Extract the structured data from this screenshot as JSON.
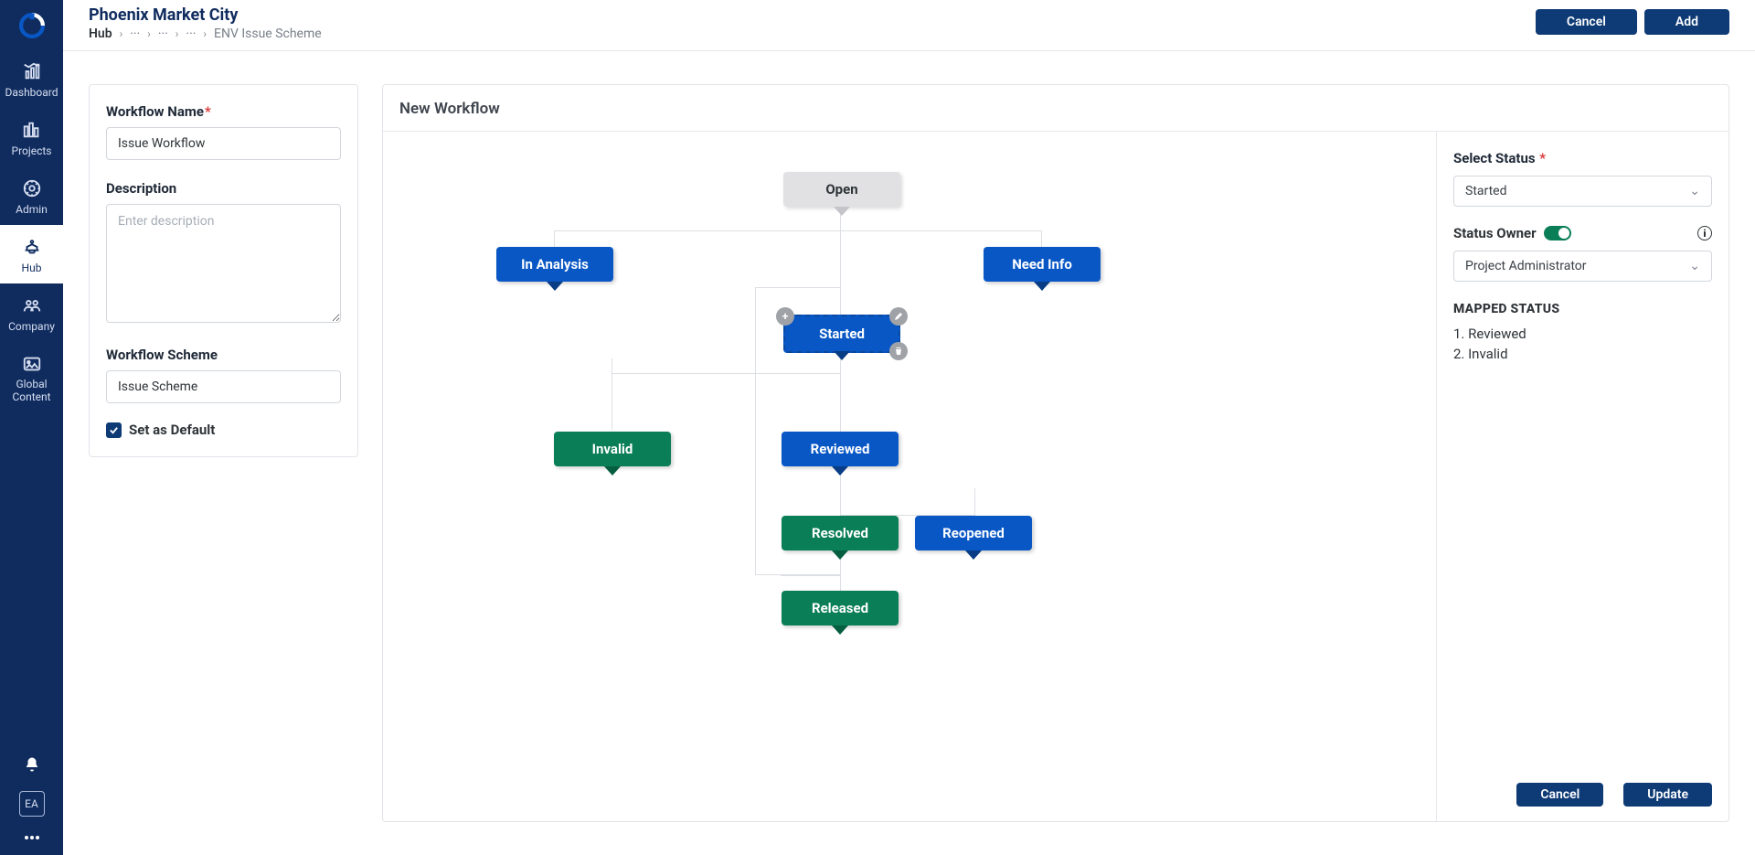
{
  "sidebar": {
    "items": [
      {
        "label": "Dashboard"
      },
      {
        "label": "Projects"
      },
      {
        "label": "Admin"
      },
      {
        "label": "Hub"
      },
      {
        "label": "Company"
      },
      {
        "label": "Global Content"
      }
    ],
    "avatar": "EA"
  },
  "header": {
    "title": "Phoenix Market City",
    "breadcrumb": {
      "root": "Hub",
      "dots": "···",
      "leaf": "ENV Issue Scheme"
    },
    "cancel": "Cancel",
    "add": "Add"
  },
  "form": {
    "name_label": "Workflow Name",
    "name_value": "Issue Workflow",
    "desc_label": "Description",
    "desc_placeholder": "Enter description",
    "scheme_label": "Workflow Scheme",
    "scheme_value": "Issue Scheme",
    "default_label": "Set as Default"
  },
  "main": {
    "title": "New Workflow"
  },
  "nodes": {
    "open": "Open",
    "in_analysis": "In Analysis",
    "need_info": "Need Info",
    "started": "Started",
    "invalid": "Invalid",
    "reviewed": "Reviewed",
    "resolved": "Resolved",
    "reopened": "Reopened",
    "released": "Released"
  },
  "inspector": {
    "select_status_label": "Select Status",
    "select_status_value": "Started",
    "owner_label": "Status Owner",
    "owner_value": "Project Administrator",
    "mapped_title": "MAPPED STATUS",
    "mapped": [
      "1. Reviewed",
      "2. Invalid"
    ],
    "cancel": "Cancel",
    "update": "Update"
  }
}
